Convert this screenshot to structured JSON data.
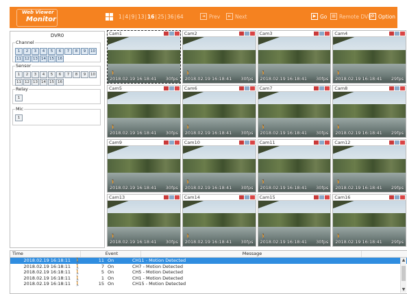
{
  "header": {
    "logo_line1": "Web Viewer",
    "logo_line2": "Monitor",
    "splits": [
      "1",
      "4",
      "9",
      "13",
      "16",
      "25",
      "36",
      "64"
    ],
    "prev_label": "Prev",
    "next_label": "Next",
    "go_label": "Go",
    "remote_dvr_label": "Remote DVR",
    "option_label": "Option"
  },
  "left_panel": {
    "dvr_title": "DVR0",
    "channel_label": "Channel",
    "channel_numbers": [
      "1",
      "2",
      "3",
      "4",
      "5",
      "6",
      "7",
      "8",
      "9",
      "10",
      "11",
      "12",
      "13",
      "14",
      "15",
      "16"
    ],
    "sensor_label": "Sensor",
    "sensor_numbers": [
      "1",
      "2",
      "3",
      "4",
      "5",
      "6",
      "7",
      "8",
      "9",
      "10",
      "11",
      "12",
      "13",
      "14",
      "15",
      "16"
    ],
    "relay_label": "Relay",
    "relay_numbers": [
      "1"
    ],
    "mic_label": "Mic",
    "mic_numbers": [
      "1"
    ]
  },
  "cameras": [
    {
      "name": "Cam1",
      "timestamp": "2018.02.19 16:18:41",
      "fps": "30fps"
    },
    {
      "name": "Cam2",
      "timestamp": "2018.02.19 16:18:41",
      "fps": "30fps"
    },
    {
      "name": "Cam3",
      "timestamp": "2018.02.19 16:18:41",
      "fps": "30fps"
    },
    {
      "name": "Cam4",
      "timestamp": "2018.02.19 16:18:41",
      "fps": "29fps"
    },
    {
      "name": "Cam5",
      "timestamp": "2018.02.19 16:18:41",
      "fps": "30fps"
    },
    {
      "name": "Cam6",
      "timestamp": "2018.02.19 16:18:41",
      "fps": "30fps"
    },
    {
      "name": "Cam7",
      "timestamp": "2018.02.19 16:18:41",
      "fps": "30fps"
    },
    {
      "name": "Cam8",
      "timestamp": "2018.02.19 16:18:41",
      "fps": "29fps"
    },
    {
      "name": "Cam9",
      "timestamp": "2018.02.19 16:18:41",
      "fps": "30fps"
    },
    {
      "name": "Cam10",
      "timestamp": "2018.02.19 16:18:41",
      "fps": "30fps"
    },
    {
      "name": "Cam11",
      "timestamp": "2018.02.19 16:18:41",
      "fps": "30fps"
    },
    {
      "name": "Cam12",
      "timestamp": "2018.02.19 16:18:41",
      "fps": "29fps"
    },
    {
      "name": "Cam13",
      "timestamp": "2018.02.19 16:18:41",
      "fps": "30fps"
    },
    {
      "name": "Cam14",
      "timestamp": "2018.02.19 16:18:41",
      "fps": "30fps"
    },
    {
      "name": "Cam15",
      "timestamp": "2018.02.19 16:18:41",
      "fps": "30fps"
    },
    {
      "name": "Cam16",
      "timestamp": "2018.02.19 16:18:41",
      "fps": "29fps"
    }
  ],
  "event_log": {
    "columns": {
      "time": "Time",
      "event": "Event",
      "message": "Message"
    },
    "rows": [
      {
        "time": "2018.02.19 16:18:11",
        "num": "11",
        "state": "On",
        "message": "CH11 - Motion Detected"
      },
      {
        "time": "2018.02.19 16:18:11",
        "num": "7",
        "state": "On",
        "message": "CH7 - Motion Detected"
      },
      {
        "time": "2018.02.19 16:18:11",
        "num": "5",
        "state": "On",
        "message": "CH5 - Motion Detected"
      },
      {
        "time": "2018.02.19 16:18:11",
        "num": "1",
        "state": "On",
        "message": "CH1 - Motion Detected"
      },
      {
        "time": "2018.02.19 16:18:11",
        "num": "15",
        "state": "On",
        "message": "CH15 - Motion Detected"
      }
    ]
  },
  "colors": {
    "header_bg": "#f58220",
    "selected_row": "#2f8de0",
    "motion_icon": "#f2a81d"
  }
}
